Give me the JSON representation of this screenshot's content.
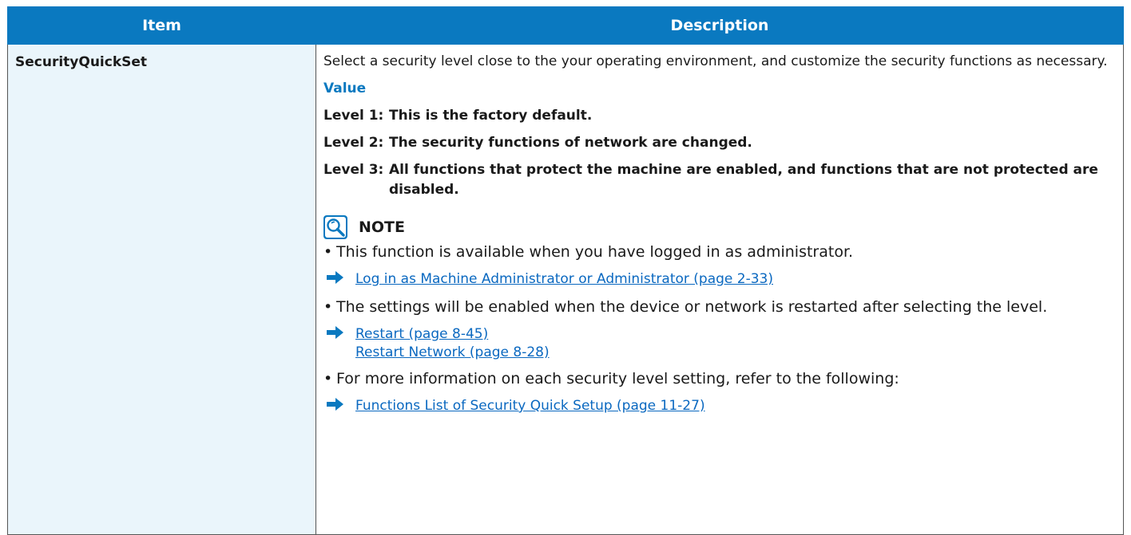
{
  "table": {
    "headers": [
      "Item",
      "Description"
    ],
    "row": {
      "item": "SecurityQuickSet",
      "intro": "Select a security level close to the your operating environment, and customize the security functions as necessary.",
      "value_heading": "Value",
      "levels": [
        {
          "key": "Level 1:",
          "text": "This is the factory default."
        },
        {
          "key": "Level 2:",
          "text": "The security functions of network are changed."
        },
        {
          "key": "Level 3:",
          "text": "All functions that protect the machine are enabled, and functions that are not protected are disabled."
        }
      ],
      "note": {
        "heading": "NOTE",
        "icon": "magnifier-note-icon",
        "bullets": [
          {
            "text": "This function is available when you have logged in as administrator.",
            "links": [
              "Log in as Machine Administrator or Administrator (page 2-33)"
            ]
          },
          {
            "text": "The settings will be enabled when the device or network is restarted after selecting the level.",
            "links": [
              "Restart (page 8-45)",
              "Restart Network (page 8-28)"
            ]
          },
          {
            "text": "For more information on each security level setting, refer to the following:",
            "links": [
              "Functions List of Security Quick Setup (page 11-27)"
            ]
          }
        ]
      }
    }
  },
  "colors": {
    "header_bg": "#0a79c0",
    "item_bg": "#eaf5fb",
    "link": "#0a68c0",
    "value_heading": "#0a79c0"
  }
}
